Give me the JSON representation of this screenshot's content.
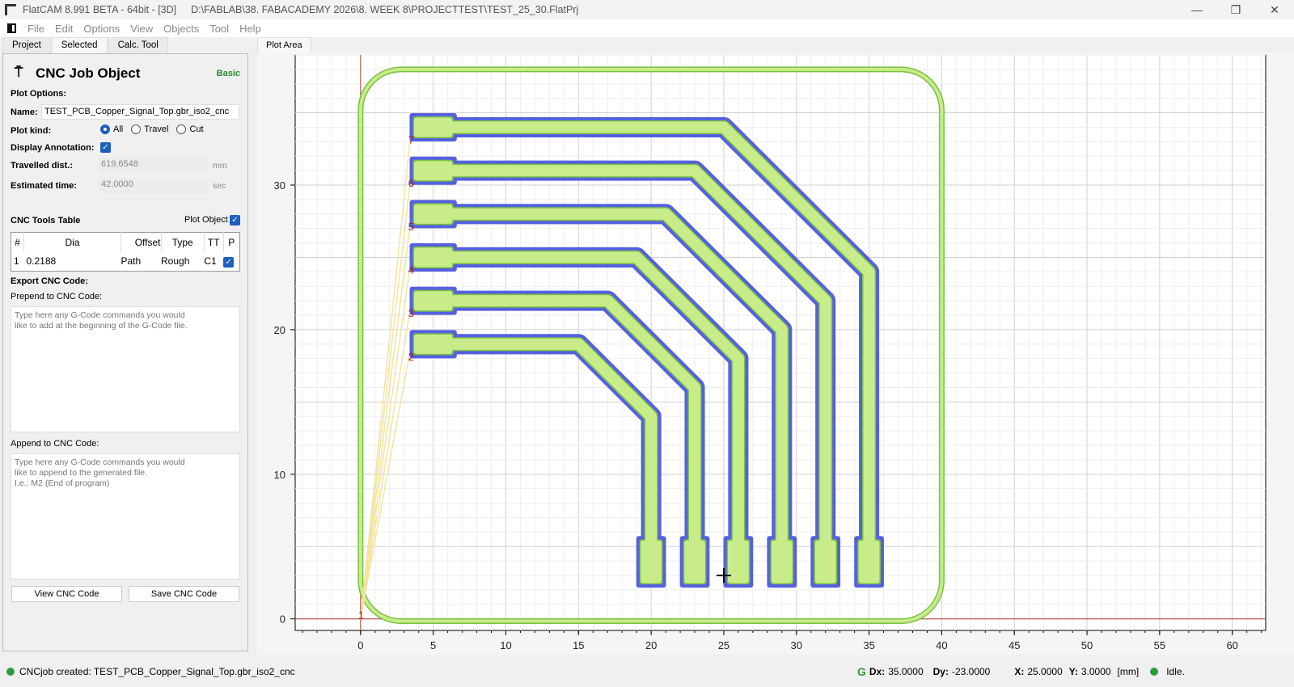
{
  "window": {
    "title": "FlatCAM 8.991 BETA - 64bit - [3D]",
    "path": "D:\\FABLAB\\38. FABACADEMY 2026\\8. WEEK 8\\PROJECTTEST\\TEST_25_30.FlatPrj",
    "minimize": "—",
    "restore": "❐",
    "close": "✕"
  },
  "menu": [
    "File",
    "Edit",
    "Options",
    "View",
    "Objects",
    "Tool",
    "Help"
  ],
  "left_tabs": [
    "Project",
    "Selected",
    "Calc. Tool"
  ],
  "panel": {
    "title": "CNC Job Object",
    "mode": "Basic",
    "plot_options": "Plot Options:",
    "name_label": "Name:",
    "name_value": "TEST_PCB_Copper_Signal_Top.gbr_iso2_cnc",
    "plot_kind_label": "Plot kind:",
    "plot_kind_options": [
      "All",
      "Travel",
      "Cut"
    ],
    "plot_kind_selected": "All",
    "display_annotation_label": "Display Annotation:",
    "display_annotation": true,
    "travelled_label": "Travelled dist.:",
    "travelled_value": "619.6548",
    "travelled_unit": "mm",
    "time_label": "Estimated time:",
    "time_value": "42.0000",
    "time_unit": "sec",
    "tools_table_label": "CNC Tools Table",
    "plot_object_label": "Plot Object",
    "plot_object": true,
    "table_headers": [
      "#",
      "Dia",
      "Offset",
      "Type",
      "TT",
      "P"
    ],
    "table_rows": [
      [
        "1",
        "0.2188",
        "Path",
        "Rough",
        "C1",
        true
      ]
    ],
    "export_label": "Export CNC Code:",
    "prepend_label": "Prepend to CNC Code:",
    "prepend_placeholder": "Type here any G-Code commands you would\nlike to add at the beginning of the G-Code file.",
    "append_label": "Append to CNC Code:",
    "append_placeholder": "Type here any G-Code commands you would\nlike to append to the generated file.\nI.e.: M2 (End of program)",
    "view_button": "View CNC Code",
    "save_button": "Save CNC Code"
  },
  "plot": {
    "tab": "Plot Area",
    "units": "mm",
    "xlim": [
      -4.5,
      62.3
    ],
    "ylim": [
      -0.8,
      39
    ],
    "x_ticks": [
      0,
      5,
      10,
      15,
      20,
      25,
      30,
      35,
      40,
      45,
      50,
      55,
      60
    ],
    "y_ticks": [
      0,
      10,
      20,
      30
    ],
    "board": {
      "x": [
        0,
        40
      ],
      "y": [
        0,
        38
      ],
      "corner_radius": 2.8
    },
    "traces": [
      {
        "label": "2",
        "pad_y": 19,
        "bend_x": 15,
        "end_x": 20
      },
      {
        "label": "3",
        "pad_y": 22,
        "bend_x": 17,
        "end_x": 23
      },
      {
        "label": "4",
        "pad_y": 25,
        "bend_x": 19,
        "end_x": 26
      },
      {
        "label": "5",
        "pad_y": 28,
        "bend_x": 21,
        "end_x": 29
      },
      {
        "label": "6",
        "pad_y": 31,
        "bend_x": 23,
        "end_x": 32
      },
      {
        "label": "7",
        "pad_y": 34,
        "bend_x": 25,
        "end_x": 35
      }
    ],
    "origin_label": "1",
    "cursor": [
      25,
      3
    ],
    "colors": {
      "cut_outline": "#5560e0",
      "fill": "#c8ec8a",
      "edge": "#7ac143",
      "travel": "#f3e4a0",
      "annotation": "#a02020",
      "axis": "#b04030"
    }
  },
  "status": {
    "message": "CNCjob created: TEST_PCB_Copper_Signal_Top.gbr_iso2_cnc",
    "g": "G",
    "dx_label": "Dx:",
    "dx": "35.0000",
    "dy_label": "Dy:",
    "dy": "-23.0000",
    "x_label": "X:",
    "x": "25.0000",
    "y_label": "Y:",
    "y": "3.0000",
    "units": "[mm]",
    "state": "Idle."
  }
}
